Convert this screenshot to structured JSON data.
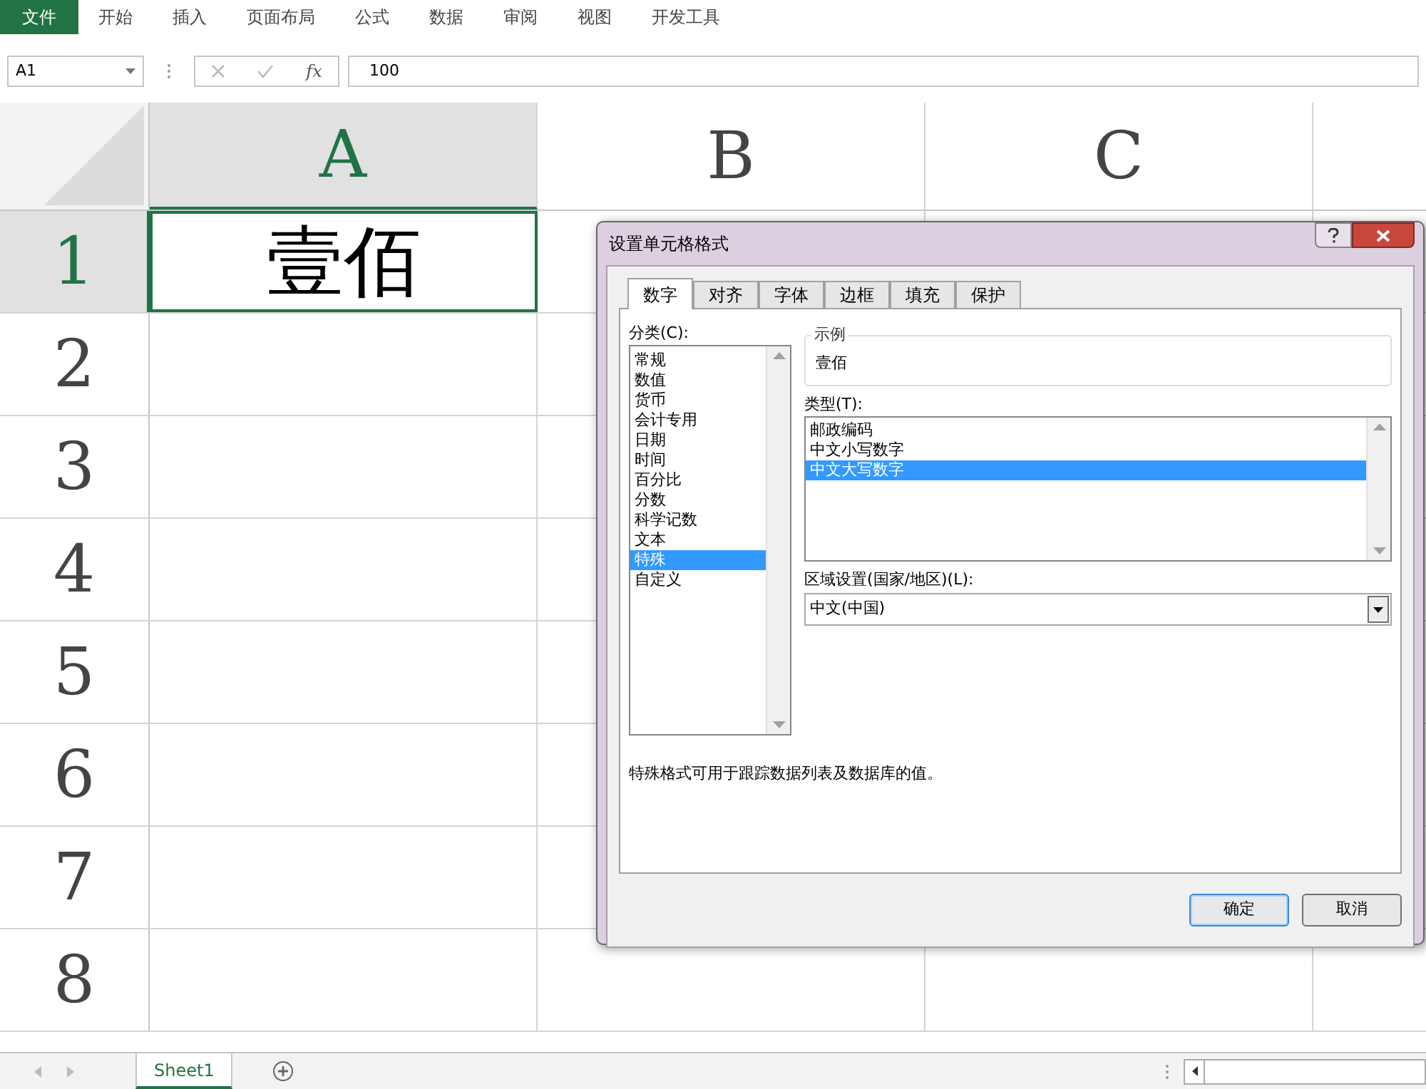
{
  "ribbon": {
    "tabs": [
      {
        "label": "文件",
        "selected": true
      },
      {
        "label": "开始",
        "selected": false
      },
      {
        "label": "插入",
        "selected": false
      },
      {
        "label": "页面布局",
        "selected": false
      },
      {
        "label": "公式",
        "selected": false
      },
      {
        "label": "数据",
        "selected": false
      },
      {
        "label": "审阅",
        "selected": false
      },
      {
        "label": "视图",
        "selected": false
      },
      {
        "label": "开发工具",
        "selected": false
      }
    ]
  },
  "formula_bar": {
    "name_box": "A1",
    "function_label": "fx",
    "value": "100"
  },
  "sheet": {
    "columns": [
      {
        "label": "A",
        "selected": true
      },
      {
        "label": "B",
        "selected": false
      },
      {
        "label": "C",
        "selected": false
      }
    ],
    "rows": [
      {
        "label": "1",
        "selected": true,
        "values": [
          "壹佰"
        ]
      },
      {
        "label": "2",
        "selected": false
      },
      {
        "label": "3",
        "selected": false
      },
      {
        "label": "4",
        "selected": false
      },
      {
        "label": "5",
        "selected": false
      },
      {
        "label": "6",
        "selected": false
      },
      {
        "label": "7",
        "selected": false
      },
      {
        "label": "8",
        "selected": false
      }
    ]
  },
  "sheet_tabs": [
    {
      "label": "Sheet1",
      "selected": true
    }
  ],
  "dialog": {
    "title": "设置单元格格式",
    "tabs": [
      {
        "label": "数字",
        "selected": true
      },
      {
        "label": "对齐",
        "selected": false
      },
      {
        "label": "字体",
        "selected": false
      },
      {
        "label": "边框",
        "selected": false
      },
      {
        "label": "填充",
        "selected": false
      },
      {
        "label": "保护",
        "selected": false
      }
    ],
    "category_label": "分类(C):",
    "categories": [
      {
        "label": "常规",
        "selected": false
      },
      {
        "label": "数值",
        "selected": false
      },
      {
        "label": "货币",
        "selected": false
      },
      {
        "label": "会计专用",
        "selected": false
      },
      {
        "label": "日期",
        "selected": false
      },
      {
        "label": "时间",
        "selected": false
      },
      {
        "label": "百分比",
        "selected": false
      },
      {
        "label": "分数",
        "selected": false
      },
      {
        "label": "科学记数",
        "selected": false
      },
      {
        "label": "文本",
        "selected": false
      },
      {
        "label": "特殊",
        "selected": true
      },
      {
        "label": "自定义",
        "selected": false
      }
    ],
    "sample_label": "示例",
    "sample_value": "壹佰",
    "type_label": "类型(T):",
    "types": [
      {
        "label": "邮政编码",
        "selected": false
      },
      {
        "label": "中文小写数字",
        "selected": false
      },
      {
        "label": "中文大写数字",
        "selected": true
      }
    ],
    "locale_label": "区域设置(国家/地区)(L):",
    "locale_value": "中文(中国)",
    "description": "特殊格式可用于跟踪数据列表及数据库的值。",
    "buttons": [
      {
        "label": "确定",
        "kind": "default"
      },
      {
        "label": "取消",
        "kind": "normal"
      }
    ]
  }
}
